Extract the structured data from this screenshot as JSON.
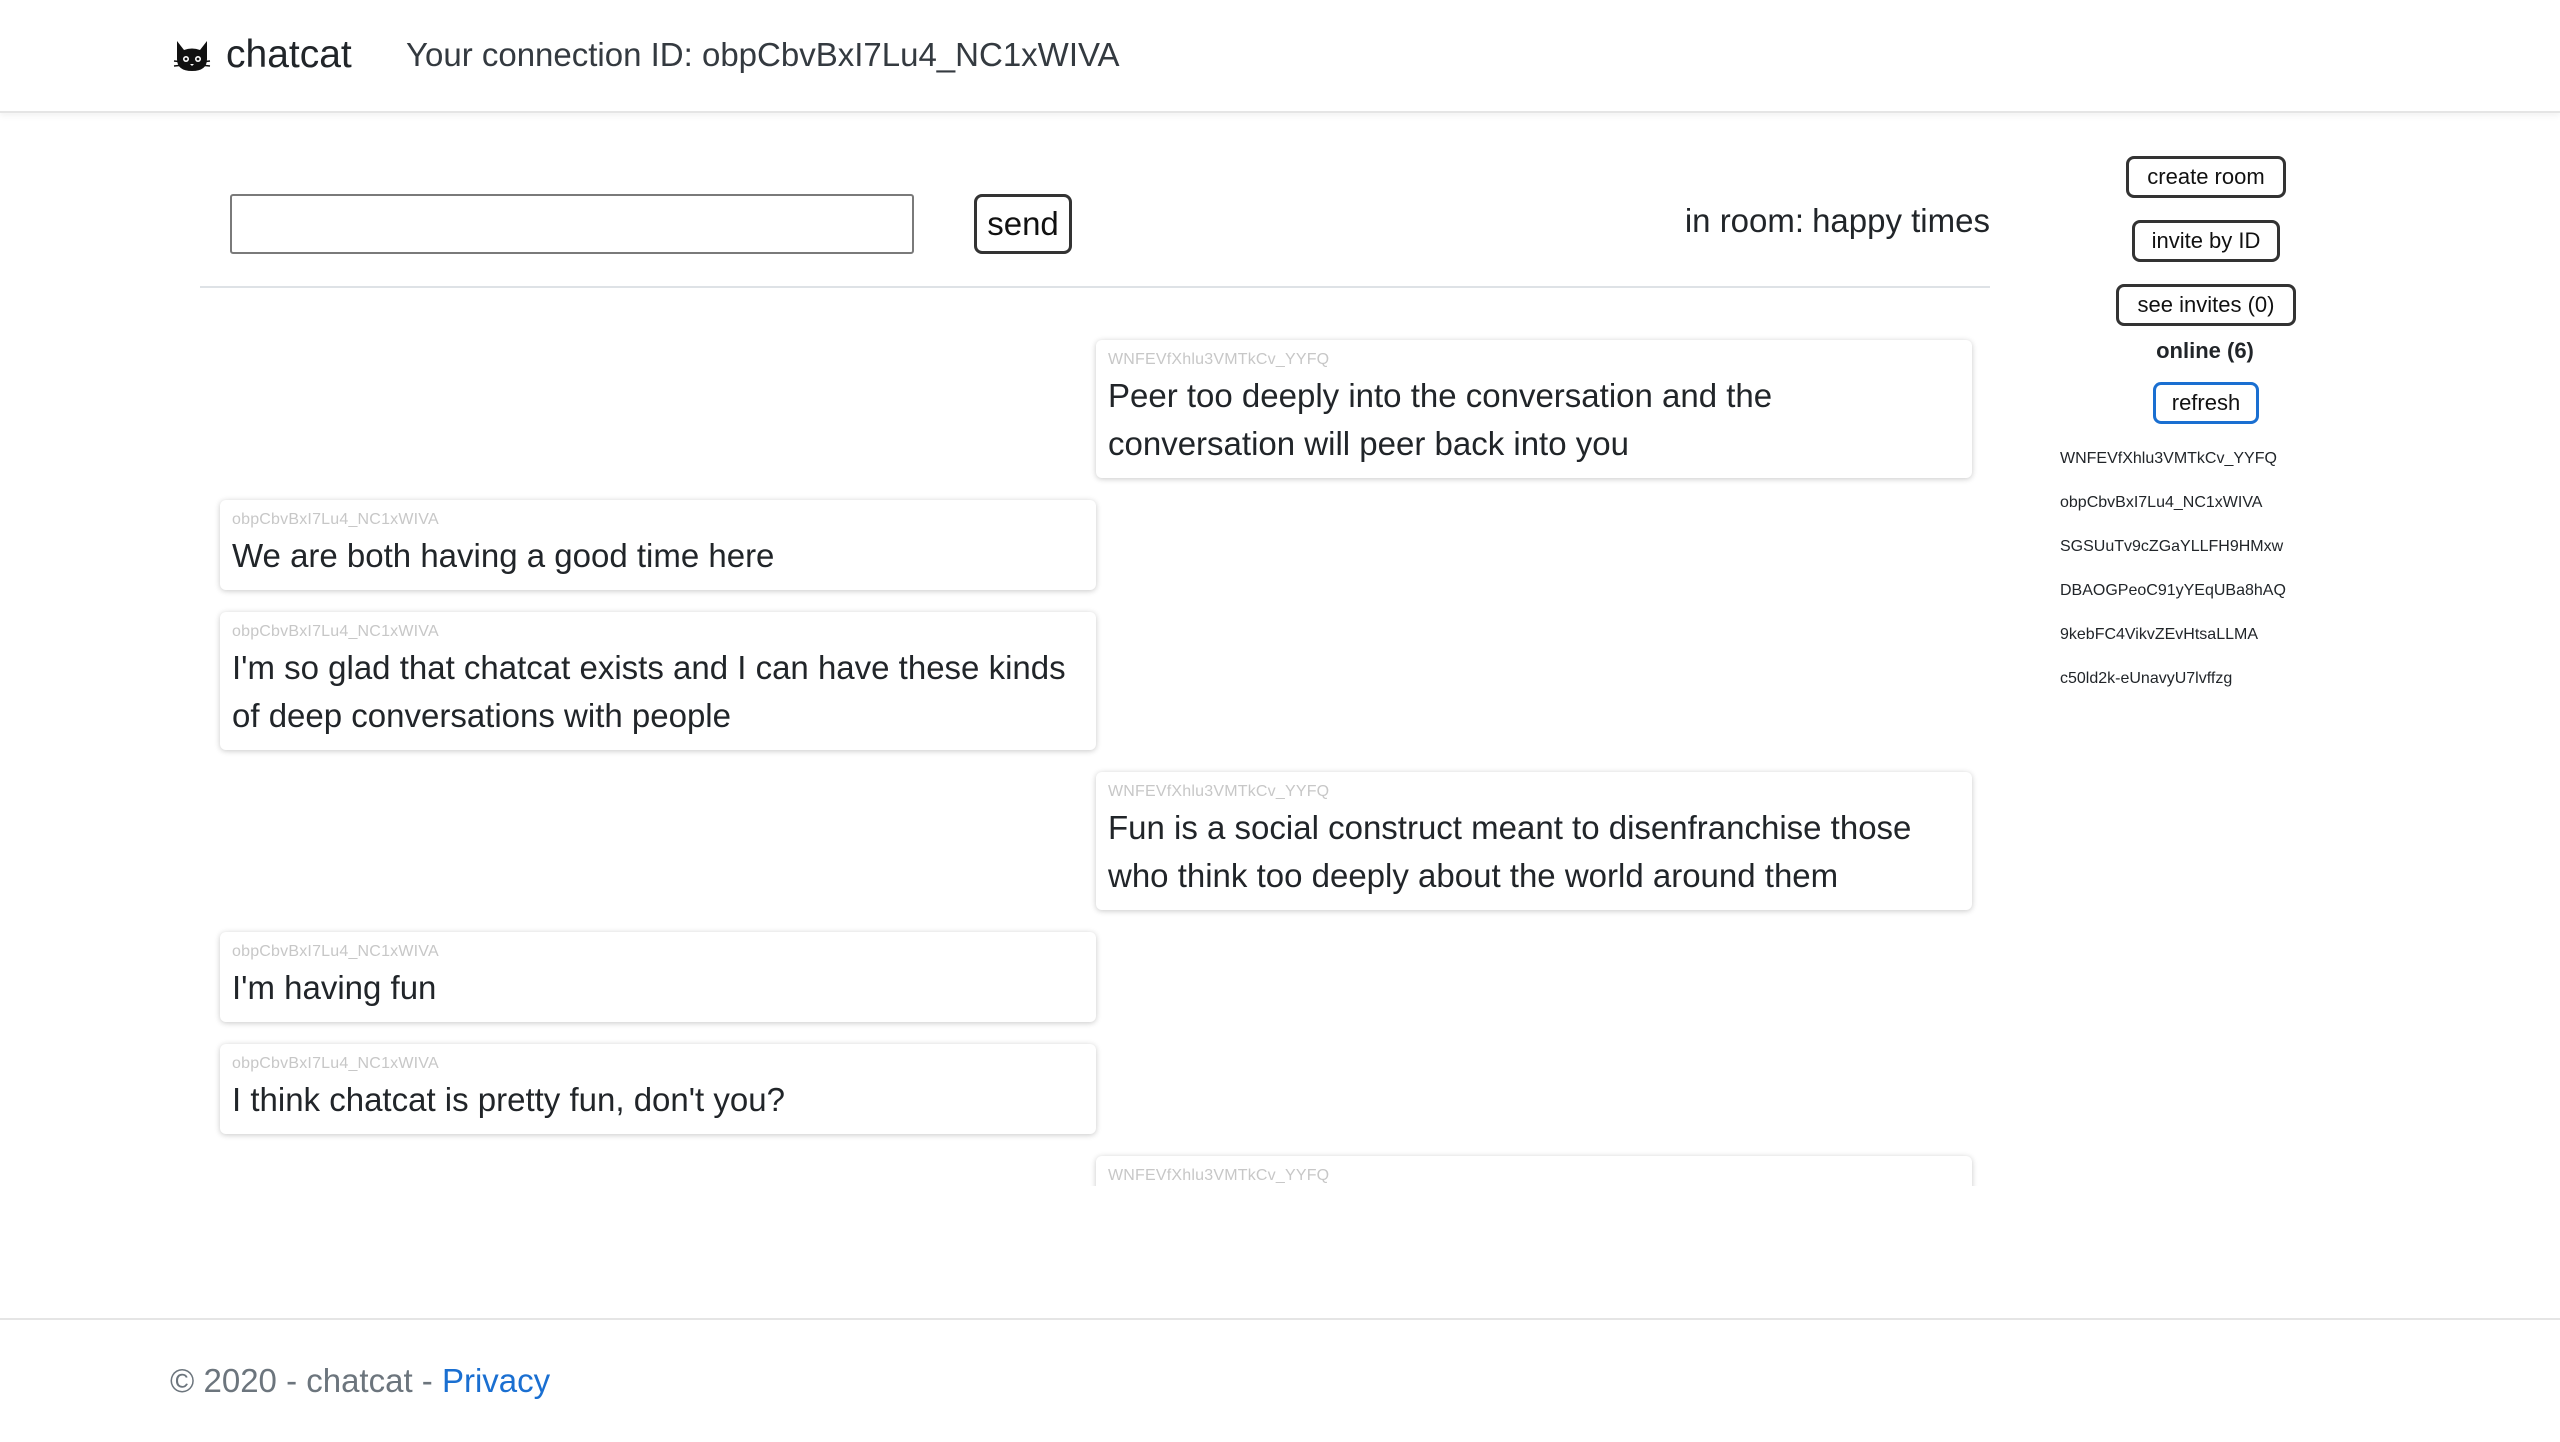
{
  "header": {
    "brand_name": "chatcat",
    "brand_icon": "cat-icon",
    "connection_label": "Your connection ID: obpCbvBxI7Lu4_NC1xWIVA"
  },
  "composer": {
    "input_value": "",
    "input_placeholder": "",
    "send_label": "send"
  },
  "room": {
    "prefix": "in room:",
    "name": "happy times"
  },
  "messages": [
    {
      "side": "right",
      "sender": "WNFEVfXhlu3VMTkCv_YYFQ",
      "text": "Peer too deeply into the conversation and the conversation will peer back into you"
    },
    {
      "side": "left",
      "sender": "obpCbvBxI7Lu4_NC1xWIVA",
      "text": "We are both having a good time here"
    },
    {
      "side": "left",
      "sender": "obpCbvBxI7Lu4_NC1xWIVA",
      "text": "I'm so glad that chatcat exists and I can have these kinds of deep conversations with people"
    },
    {
      "side": "right",
      "sender": "WNFEVfXhlu3VMTkCv_YYFQ",
      "text": "Fun is a social construct meant to disenfranchise those who think too deeply about the world around them"
    },
    {
      "side": "left",
      "sender": "obpCbvBxI7Lu4_NC1xWIVA",
      "text": "I'm having fun"
    },
    {
      "side": "left",
      "sender": "obpCbvBxI7Lu4_NC1xWIVA",
      "text": "I think chatcat is pretty fun, don't you?"
    },
    {
      "side": "right",
      "sender": "WNFEVfXhlu3VMTkCv_YYFQ",
      "text": ""
    }
  ],
  "sidebar": {
    "create_room_label": "create room",
    "invite_by_id_label": "invite by ID",
    "see_invites_label": "see invites (0)",
    "online_label": "online (6)",
    "refresh_label": "refresh",
    "online_users": [
      "WNFEVfXhlu3VMTkCv_YYFQ",
      "obpCbvBxI7Lu4_NC1xWIVA",
      "SGSUuTv9cZGaYLLFH9HMxw",
      "DBAOGPeoC91yYEqUBa8hAQ",
      "9kebFC4VikvZEvHtsaLLMA",
      "c50ld2k-eUnavyU7lvffzg"
    ]
  },
  "footer": {
    "copyright": "© 2020 - chatcat -",
    "privacy_label": "Privacy"
  },
  "colors": {
    "link": "#1a6fd1",
    "sender_text": "#c7c7c7",
    "refresh_border": "#1a6fd1"
  }
}
